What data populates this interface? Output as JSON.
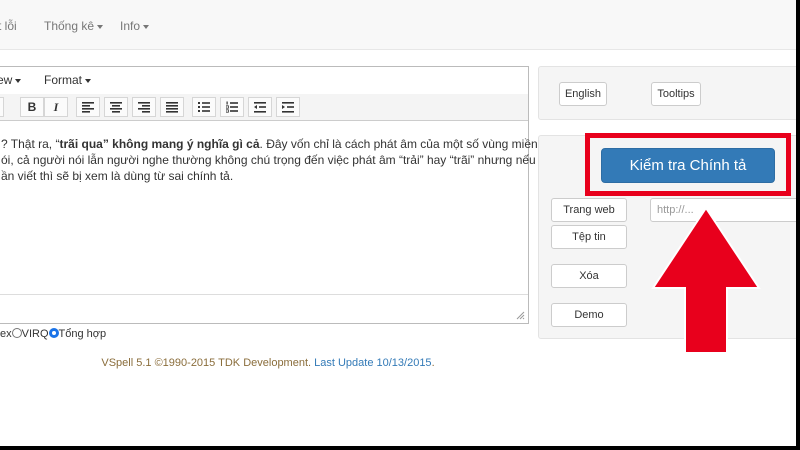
{
  "navbar": {
    "items": [
      {
        "label": "t lỗi",
        "dropdown": false
      },
      {
        "label": "Thống kê",
        "dropdown": true
      },
      {
        "label": "Info",
        "dropdown": true
      }
    ]
  },
  "editor": {
    "menus": [
      "ew",
      "Format"
    ],
    "toolbar": [
      "B",
      "I"
    ],
    "content": {
      "line1": {
        "a": "? Thật ra, “",
        "b": "trãi qua",
        "c": "” ",
        "d": "không mang ý nghĩa gì cả",
        "e": ". Đây vốn chỉ là cách phát âm của một số vùng miền"
      },
      "line2": "ói, cả người nói lẫn người nghe thường không chú trọng đến việc phát âm “trải” hay “trãi” nhưng nếu",
      "line3": "ần viết thì sẽ bị xem là dùng từ sai chính tả."
    }
  },
  "modes": {
    "partial_label": "ex",
    "options": [
      {
        "label": "VIRQ",
        "selected": false
      },
      {
        "label": "Tổng hợp",
        "selected": true
      }
    ]
  },
  "footer": {
    "text": "VSpell 5.1 ©1990-2015 TDK Development. ",
    "link": "Last Update 10/13/2015",
    "tail": "."
  },
  "right_panel": {
    "language_button": "English",
    "tooltips_button": "Tooltips",
    "check_button": "Kiểm tra Chính tả",
    "webpage_button": "Trang web",
    "url_placeholder": "http://...",
    "file_button": "Tệp tin",
    "delete_button": "Xóa",
    "demo_button": "Demo"
  },
  "colors": {
    "primary": "#337ab7",
    "highlight": "#e8001c",
    "link": "#337ab7",
    "footer_text": "#8a6d3b"
  }
}
